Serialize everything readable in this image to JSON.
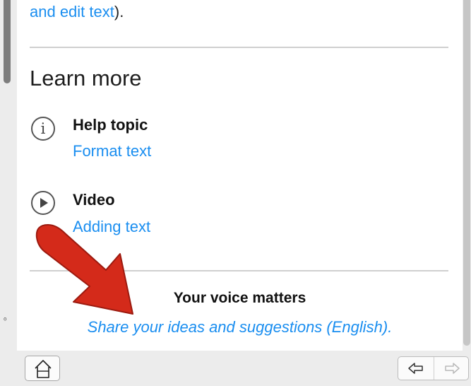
{
  "panel": {
    "top_link_partial": "and edit text",
    "top_link_suffix": ").",
    "section_title": "Learn more",
    "items": [
      {
        "icon": "info-circle-icon",
        "title": "Help topic",
        "link": "Format text"
      },
      {
        "icon": "play-circle-icon",
        "title": "Video",
        "link": "Adding text"
      }
    ],
    "voice_title": "Your voice matters",
    "voice_link": "Share your ideas and suggestions (English)."
  },
  "annotation": {
    "icon": "red-arrow-annotation",
    "color": "#d42a1a"
  },
  "footer": {
    "home_icon": "home-icon",
    "back_icon": "back-arrow-icon",
    "forward_icon": "forward-arrow-icon"
  },
  "colors": {
    "link": "#1a8ef0",
    "background": "#ececec",
    "panel": "#ffffff"
  }
}
